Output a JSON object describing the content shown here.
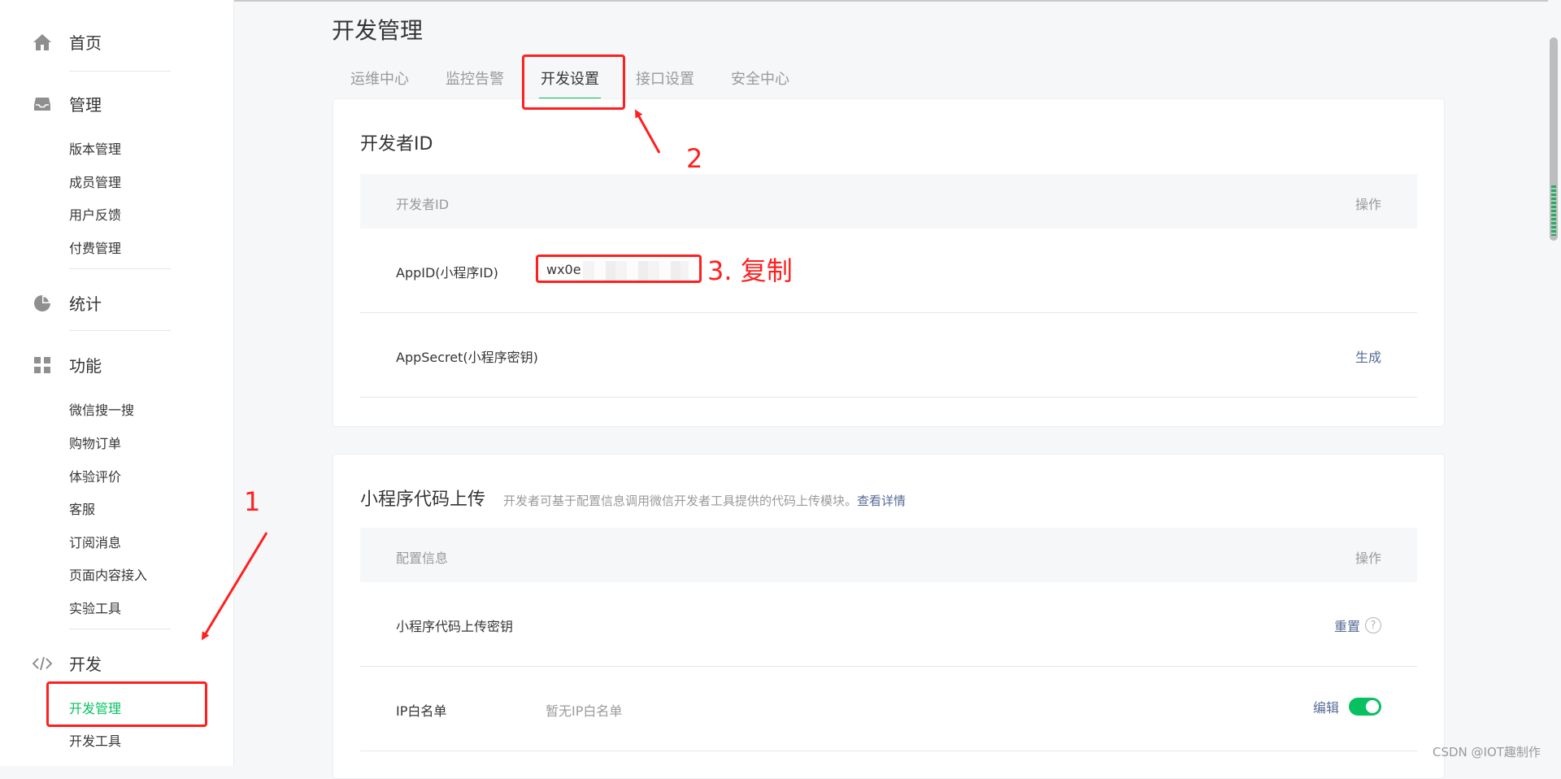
{
  "sidebar": {
    "home": "首页",
    "manage": {
      "title": "管理",
      "items": [
        "版本管理",
        "成员管理",
        "用户反馈",
        "付费管理"
      ]
    },
    "stats": "统计",
    "features": {
      "title": "功能",
      "items": [
        "微信搜一搜",
        "购物订单",
        "体验评价",
        "客服",
        "订阅消息",
        "页面内容接入",
        "实验工具"
      ]
    },
    "dev": {
      "title": "开发",
      "items": [
        "开发管理",
        "开发工具"
      ]
    }
  },
  "page": {
    "title": "开发管理",
    "tabs": [
      "运维中心",
      "监控告警",
      "开发设置",
      "接口设置",
      "安全中心"
    ],
    "active_tab": "开发设置"
  },
  "developer_id": {
    "title": "开发者ID",
    "header": {
      "col1": "开发者ID",
      "col2": "操作"
    },
    "rows": [
      {
        "label": "AppID(小程序ID)",
        "value": "wx0e",
        "action": ""
      },
      {
        "label": "AppSecret(小程序密钥)",
        "value": "",
        "action": "生成"
      }
    ]
  },
  "code_upload": {
    "title": "小程序代码上传",
    "desc": "开发者可基于配置信息调用微信开发者工具提供的代码上传模块。",
    "desc_link": "查看详情",
    "header": {
      "col1": "配置信息",
      "col2": "操作"
    },
    "rows": [
      {
        "label": "小程序代码上传密钥",
        "value": "",
        "action": "重置"
      },
      {
        "label": "IP白名单",
        "value": "暂无IP白名单",
        "action": "编辑"
      }
    ],
    "ip_whitelist_enabled": true
  },
  "annotations": {
    "n1": "1",
    "n2": "2",
    "n3": "3. 复制"
  },
  "watermark": "CSDN @IOT趣制作",
  "colors": {
    "accent": "#07c160",
    "link": "#576b95",
    "annotation": "#ff1f1f"
  },
  "icons": {
    "home": "home-icon",
    "manage": "inbox-icon",
    "stats": "pie-chart-icon",
    "features": "grid-icon",
    "dev": "code-icon",
    "help": "question-circle-icon"
  }
}
